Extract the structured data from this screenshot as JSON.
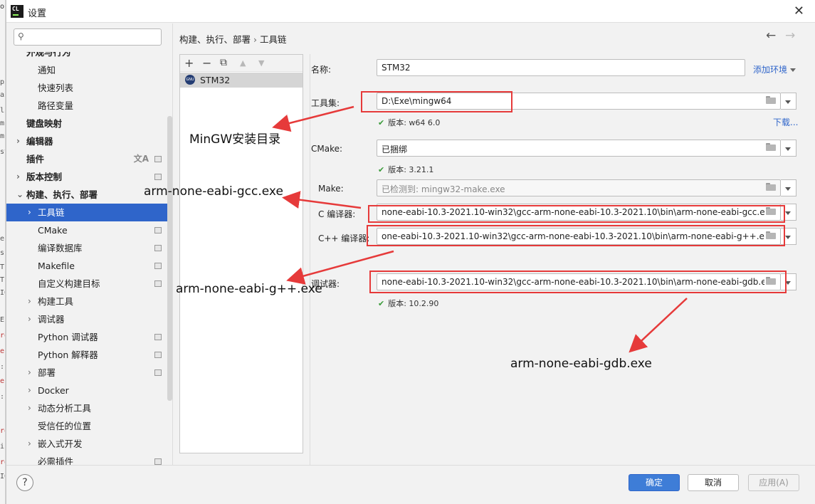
{
  "window": {
    "title": "设置",
    "app_icon_text": "CL"
  },
  "sidebar": {
    "search_placeholder": "",
    "items": [
      {
        "label": "外观与行为",
        "bold": true,
        "arrow": false,
        "indent": 0
      },
      {
        "label": "通知",
        "bold": false,
        "arrow": false,
        "indent": 1
      },
      {
        "label": "快速列表",
        "bold": false,
        "arrow": false,
        "indent": 1
      },
      {
        "label": "路径变量",
        "bold": false,
        "arrow": false,
        "indent": 1
      },
      {
        "label": "键盘映射",
        "bold": true,
        "arrow": false,
        "indent": 0
      },
      {
        "label": "编辑器",
        "bold": true,
        "arrow": true,
        "indent": 0
      },
      {
        "label": "插件",
        "bold": true,
        "arrow": false,
        "indent": 0
      },
      {
        "label": "版本控制",
        "bold": true,
        "arrow": true,
        "indent": 0
      },
      {
        "label": "构建、执行、部署",
        "bold": true,
        "arrow": true,
        "indent": 0
      },
      {
        "label": "工具链",
        "bold": false,
        "arrow": true,
        "indent": 1
      },
      {
        "label": "CMake",
        "bold": false,
        "arrow": false,
        "indent": 1
      },
      {
        "label": "编译数据库",
        "bold": false,
        "arrow": false,
        "indent": 1
      },
      {
        "label": "Makefile",
        "bold": false,
        "arrow": false,
        "indent": 1
      },
      {
        "label": "自定义构建目标",
        "bold": false,
        "arrow": false,
        "indent": 1
      },
      {
        "label": "构建工具",
        "bold": false,
        "arrow": true,
        "indent": 1
      },
      {
        "label": "调试器",
        "bold": false,
        "arrow": true,
        "indent": 1
      },
      {
        "label": "Python 调试器",
        "bold": false,
        "arrow": false,
        "indent": 1
      },
      {
        "label": "Python 解释器",
        "bold": false,
        "arrow": false,
        "indent": 1
      },
      {
        "label": "部署",
        "bold": false,
        "arrow": true,
        "indent": 1
      },
      {
        "label": "Docker",
        "bold": false,
        "arrow": true,
        "indent": 1
      },
      {
        "label": "动态分析工具",
        "bold": false,
        "arrow": true,
        "indent": 1
      },
      {
        "label": "受信任的位置",
        "bold": false,
        "arrow": false,
        "indent": 1
      },
      {
        "label": "嵌入式开发",
        "bold": false,
        "arrow": true,
        "indent": 1
      },
      {
        "label": "必需插件",
        "bold": false,
        "arrow": false,
        "indent": 1
      }
    ]
  },
  "breadcrumb": {
    "parent": "构建、执行、部署",
    "separator": "›",
    "current": "工具链"
  },
  "toolchains": {
    "toolbar": {
      "add": "+",
      "remove": "−",
      "copy": "⧉",
      "up": "▲",
      "down": "▼"
    },
    "list": [
      {
        "name": "STM32",
        "icon": "gnu-icon"
      }
    ]
  },
  "form": {
    "name_label": "名称:",
    "name_value": "STM32",
    "add_env_label": "添加环境",
    "toolset_label": "工具集:",
    "toolset_value": "D:\\Exe\\mingw64",
    "toolset_version": "版本: w64 6.0",
    "download_label": "下载...",
    "cmake_label": "CMake:",
    "cmake_value": "已捆绑",
    "cmake_version": "版本: 3.21.1",
    "make_label": "Make:",
    "make_value": "已检测到: mingw32-make.exe",
    "c_compiler_label": "C 编译器:",
    "c_compiler_value": "none-eabi-10.3-2021.10-win32\\gcc-arm-none-eabi-10.3-2021.10\\bin\\arm-none-eabi-gcc.exe",
    "cpp_compiler_label": "C++ 编译器:",
    "cpp_compiler_value": "one-eabi-10.3-2021.10-win32\\gcc-arm-none-eabi-10.3-2021.10\\bin\\arm-none-eabi-g++.exe",
    "debugger_label": "调试器:",
    "debugger_value": "none-eabi-10.3-2021.10-win32\\gcc-arm-none-eabi-10.3-2021.10\\bin\\arm-none-eabi-gdb.exe",
    "debugger_version": "版本: 10.2.90"
  },
  "annotations": {
    "mingw": "MinGW安装目录",
    "gcc": "arm-none-eabi-gcc.exe",
    "gpp": "arm-none-eabi-g++.exe",
    "gdb": "arm-none-eabi-gdb.exe"
  },
  "footer": {
    "help": "?",
    "ok": "确定",
    "cancel": "取消",
    "apply": "应用(A)"
  },
  "colors": {
    "accent": "#2f65ca",
    "annotation_red": "#e63a3a",
    "check_green": "#3a9b3a"
  }
}
